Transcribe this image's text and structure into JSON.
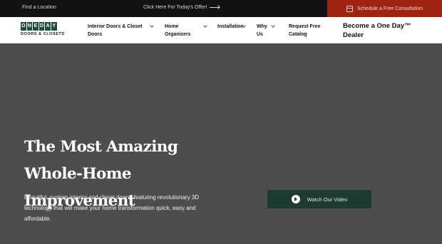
{
  "topbar": {
    "find_location": "Find a Location",
    "offer": "Click Here For Today's Offer!",
    "consultation": "Schedule a Free Consultation"
  },
  "logo": {
    "letters": [
      "O",
      "N",
      "E",
      "D",
      "A",
      "Y"
    ],
    "subtitle": "DOORS & CLOSETS"
  },
  "nav": {
    "items": [
      {
        "label": "Interior Doors & Closet Doors",
        "has_dropdown": true
      },
      {
        "label": "Home Organizers",
        "has_dropdown": true
      },
      {
        "label": "Installation",
        "has_dropdown": true
      },
      {
        "label": "Why Us",
        "has_dropdown": true
      },
      {
        "label": "Request Free Catalog",
        "has_dropdown": false
      }
    ],
    "dealer": "Become a One Day™ Dealer"
  },
  "hero": {
    "title": "The Most Amazing Whole-Home Improvement",
    "description": "Beautiful, custom interior and closet doors, featuring revolutionary 3D technology that will make your home transformation quick, easy and affordable.",
    "video_button": "Watch Our Video"
  },
  "colors": {
    "topbar_bg": "#121212",
    "consult_bg": "#9e2411",
    "brand_green": "#1f4d3c",
    "hero_bg": "#4d4d4d",
    "video_btn_bg": "#1d3b30"
  },
  "icons": {
    "calendar": "calendar-icon",
    "arrow": "arrow-right-icon",
    "chevron": "chevron-down-icon",
    "play": "play-icon"
  }
}
